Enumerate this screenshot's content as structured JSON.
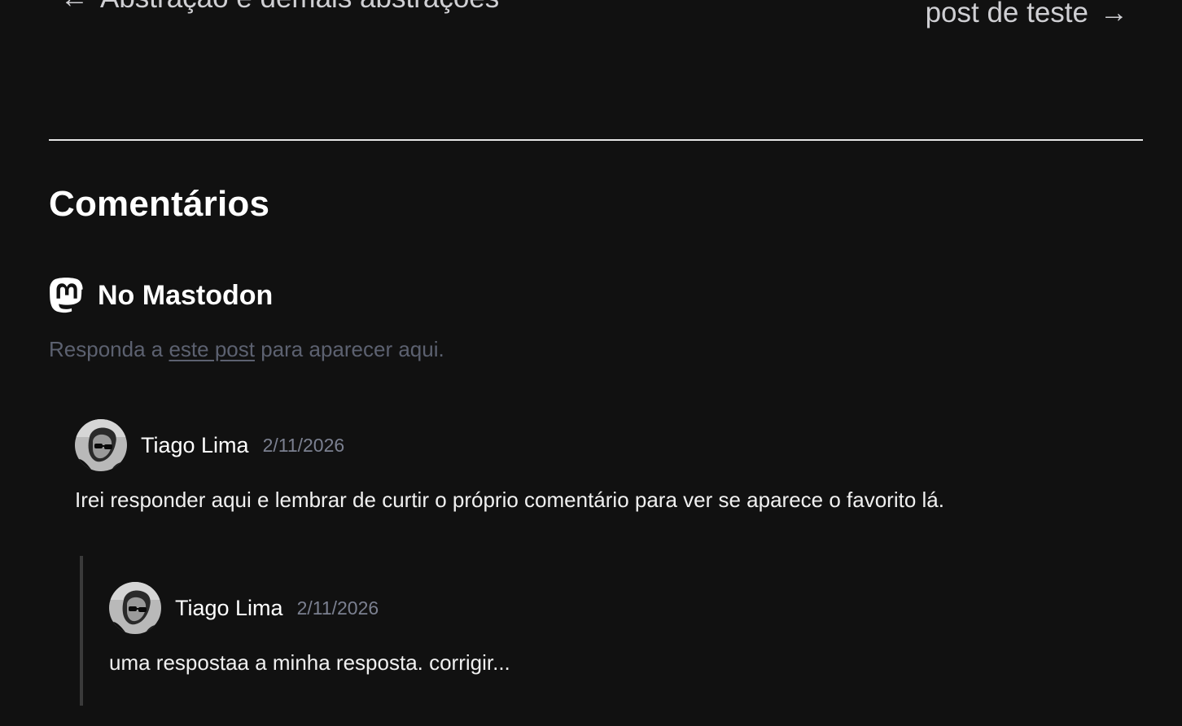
{
  "post_nav": {
    "prev_arrow": "←",
    "prev_label": "Abstração e demais abstrações",
    "next_label": "post de teste",
    "next_arrow": "→"
  },
  "comments_section": {
    "title": "Comentários",
    "mastodon_heading": "No Mastodon",
    "reply_prefix": "Responda a",
    "reply_link": "este post",
    "reply_suffix": "para aparecer aqui."
  },
  "comments": [
    {
      "author": "Tiago Lima",
      "date": "2/11/2026",
      "text": "Irei responder aqui e lembrar de curtir o próprio comentário para ver se aparece o favorito lá."
    },
    {
      "author": "Tiago Lima",
      "date": "2/11/2026",
      "text": "uma respostaa a minha resposta. corrigir..."
    }
  ],
  "colors": {
    "background": "#111111",
    "divider": "#e6e6e6",
    "muted_text": "#5c6170",
    "date_text": "#7b8090",
    "thread_line": "#3a3a3a"
  },
  "icons": {
    "mastodon": "mastodon-icon"
  }
}
